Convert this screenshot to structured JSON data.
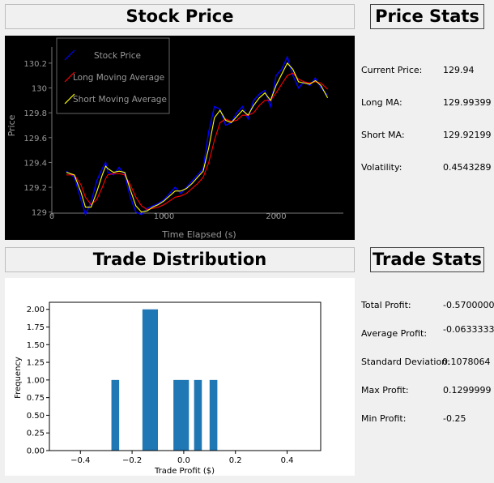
{
  "headers": {
    "stock_price": "Stock Price",
    "price_stats": "Price Stats",
    "trade_distribution": "Trade Distribution",
    "trade_stats": "Trade Stats"
  },
  "price_stats": [
    {
      "label": "Current Price:",
      "value": "129.94"
    },
    {
      "label": "Long MA:",
      "value": "129.99399"
    },
    {
      "label": "Short MA:",
      "value": "129.92199"
    },
    {
      "label": "Volatility:",
      "value": "0.4543289"
    }
  ],
  "trade_stats": [
    {
      "label": "Total Profit:",
      "value": "-0.5700000"
    },
    {
      "label": "Average Profit:",
      "value": "-0.0633333"
    },
    {
      "label": "Standard Deviation:",
      "value": "0.1078064"
    },
    {
      "label": "Max Profit:",
      "value": "0.1299999"
    },
    {
      "label": "Min Profit:",
      "value": "-0.25"
    }
  ],
  "colors": {
    "price": "#0000ff",
    "long_ma": "#ff0000",
    "short_ma": "#ffff00",
    "bar": "#1f77b4"
  },
  "chart_data": [
    {
      "type": "line",
      "xlabel": "Time Elapsed (s)",
      "ylabel": "Price",
      "xlim": [
        0,
        2600
      ],
      "ylim": [
        128.75,
        130.33
      ],
      "xticks": [
        0,
        1000,
        2000
      ],
      "yticks": [
        129.0,
        129.2,
        129.4,
        129.6,
        129.8,
        130.0,
        130.2
      ],
      "ytick_labels": [
        "129",
        "129.2",
        "129.4",
        "129.6",
        "129.8",
        "130",
        "130.2"
      ],
      "legend_position": "top-left",
      "x": [
        130,
        200,
        260,
        300,
        350,
        400,
        450,
        480,
        500,
        550,
        600,
        650,
        700,
        750,
        800,
        850,
        900,
        950,
        1000,
        1050,
        1100,
        1150,
        1200,
        1250,
        1300,
        1350,
        1400,
        1450,
        1500,
        1550,
        1600,
        1650,
        1700,
        1750,
        1800,
        1850,
        1900,
        1950,
        2000,
        2050,
        2100,
        2150,
        2200,
        2250,
        2300,
        2350,
        2400,
        2460
      ],
      "series": [
        {
          "name": "Stock Price",
          "color": "#0000ff",
          "values": [
            129.33,
            129.28,
            129.1,
            128.98,
            129.08,
            129.25,
            129.35,
            129.4,
            129.32,
            129.3,
            129.36,
            129.3,
            129.12,
            129.0,
            128.98,
            129.03,
            129.05,
            129.07,
            129.1,
            129.15,
            129.2,
            129.15,
            129.2,
            129.25,
            129.3,
            129.35,
            129.65,
            129.85,
            129.83,
            129.7,
            129.72,
            129.8,
            129.85,
            129.75,
            129.9,
            129.95,
            129.98,
            129.85,
            130.1,
            130.15,
            130.25,
            130.1,
            130.0,
            130.05,
            130.02,
            130.08,
            130.0,
            129.94
          ]
        },
        {
          "name": "Long Moving Average",
          "color": "#ff0000",
          "values": [
            129.3,
            129.3,
            129.22,
            129.12,
            129.06,
            129.1,
            129.2,
            129.27,
            129.3,
            129.31,
            129.31,
            129.3,
            129.22,
            129.12,
            129.05,
            129.02,
            129.03,
            129.04,
            129.06,
            129.09,
            129.12,
            129.13,
            129.15,
            129.19,
            129.23,
            129.28,
            129.4,
            129.58,
            129.72,
            129.75,
            129.73,
            129.74,
            129.78,
            129.78,
            129.8,
            129.86,
            129.9,
            129.9,
            129.96,
            130.03,
            130.1,
            130.12,
            130.07,
            130.05,
            130.04,
            130.05,
            130.04,
            129.99
          ]
        },
        {
          "name": "Short Moving Average",
          "color": "#ffff00",
          "values": [
            129.32,
            129.3,
            129.16,
            129.04,
            129.04,
            129.16,
            129.3,
            129.37,
            129.35,
            129.32,
            129.33,
            129.32,
            129.18,
            129.05,
            129.0,
            129.01,
            129.04,
            129.06,
            129.09,
            129.13,
            129.17,
            129.17,
            129.19,
            129.23,
            129.28,
            129.33,
            129.52,
            129.76,
            129.82,
            129.74,
            129.72,
            129.77,
            129.82,
            129.78,
            129.86,
            129.92,
            129.96,
            129.9,
            130.02,
            130.11,
            130.2,
            130.15,
            130.05,
            130.04,
            130.03,
            130.06,
            130.02,
            129.92
          ]
        }
      ]
    },
    {
      "type": "bar",
      "xlabel": "Trade Profit ($)",
      "ylabel": "Frequency",
      "xlim": [
        -0.52,
        0.53
      ],
      "ylim": [
        0,
        2.1
      ],
      "xticks": [
        -0.4,
        -0.2,
        0.0,
        0.2,
        0.4
      ],
      "xtick_labels": [
        "−0.4",
        "−0.2",
        "0.0",
        "0.2",
        "0.4"
      ],
      "yticks": [
        0,
        0.25,
        0.5,
        0.75,
        1.0,
        1.25,
        1.5,
        1.75,
        2.0
      ],
      "ytick_labels": [
        "0.00",
        "0.25",
        "0.50",
        "0.75",
        "1.00",
        "1.25",
        "1.50",
        "1.75",
        "2.00"
      ],
      "bars": [
        {
          "left": -0.28,
          "right": -0.25,
          "value": 1
        },
        {
          "left": -0.16,
          "right": -0.1,
          "value": 2
        },
        {
          "left": -0.04,
          "right": 0.02,
          "value": 1
        },
        {
          "left": 0.04,
          "right": 0.07,
          "value": 1
        },
        {
          "left": 0.1,
          "right": 0.13,
          "value": 1
        }
      ]
    }
  ]
}
